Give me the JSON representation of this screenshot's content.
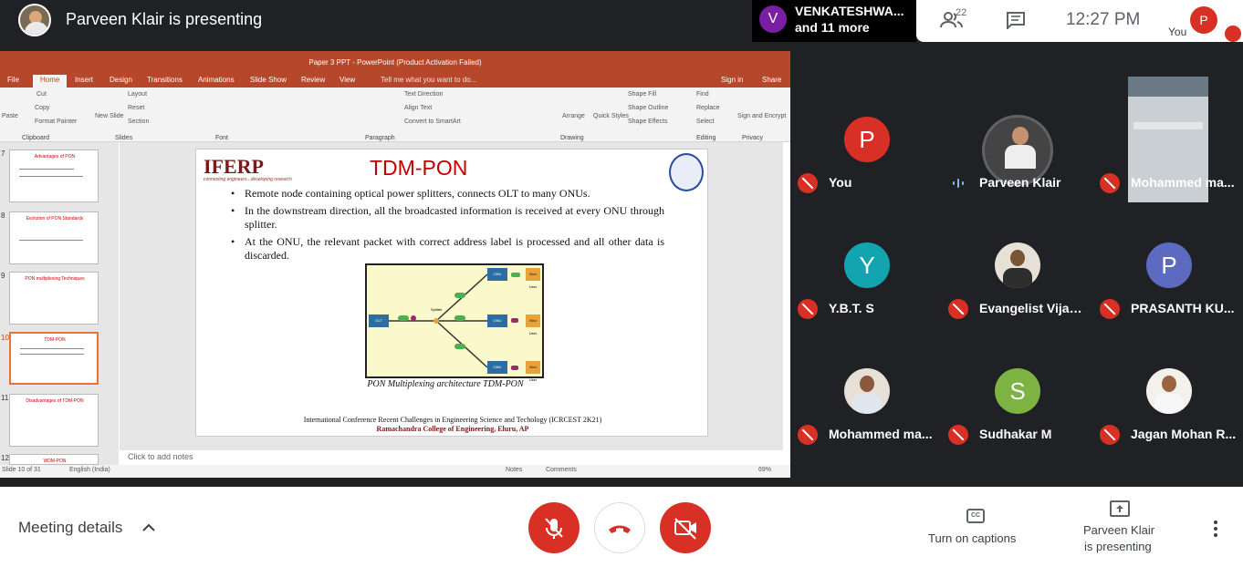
{
  "topbar": {
    "presenter_title": "Parveen Klair is presenting",
    "participant_name": "VENKATESHWA...",
    "participant_more": "and 11 more",
    "participant_initial": "V",
    "people_count": "22",
    "time": "12:27  PM",
    "self_initial": "P",
    "self_label": "You"
  },
  "ppt": {
    "title": "Paper 3 PPT - PowerPoint (Product Activation Failed)",
    "tabs": [
      "File",
      "Home",
      "Insert",
      "Design",
      "Transitions",
      "Animations",
      "Slide Show",
      "Review",
      "View"
    ],
    "tell_me": "Tell me what you want to do...",
    "sign_in": "Sign in",
    "share": "Share",
    "groups": [
      "Clipboard",
      "Slides",
      "Font",
      "Paragraph",
      "Drawing",
      "Editing",
      "Privacy"
    ],
    "buttons": {
      "paste": "Paste",
      "cut": "Cut",
      "copy": "Copy",
      "format_painter": "Format Painter",
      "new_slide": "New Slide",
      "layout": "Layout",
      "reset": "Reset",
      "section": "Section",
      "text_direction": "Text Direction",
      "align_text": "Align Text",
      "convert_smartart": "Convert to SmartArt",
      "arrange": "Arrange",
      "quick_styles": "Quick Styles",
      "shape_fill": "Shape Fill",
      "shape_outline": "Shape Outline",
      "shape_effects": "Shape Effects",
      "find": "Find",
      "replace": "Replace",
      "select": "Select",
      "sign_encrypt": "Sign and Encrypt"
    },
    "thumbnails": [
      {
        "num": "7",
        "title": "Advantages of PON"
      },
      {
        "num": "8",
        "title": "Evolution of PON Standards"
      },
      {
        "num": "9",
        "title": "PON multiplexing Techniques"
      },
      {
        "num": "10",
        "title": "TDM-PON"
      },
      {
        "num": "11",
        "title": "Disadvantages of TDM-PON"
      },
      {
        "num": "12",
        "title": "WDM-PON"
      }
    ],
    "notes_placeholder": "Click to add notes",
    "status_slide": "Slide 10 of 31",
    "status_lang": "English (India)",
    "status_notes": "Notes",
    "status_comments": "Comments",
    "zoom": "69%"
  },
  "slide": {
    "brand": "IFERP",
    "brand_tag": "connecting engineers...developing research",
    "title": "TDM-PON",
    "bullets": [
      "Remote node containing optical power splitters, connects OLT to many ONUs.",
      "In the downstream direction, all the broadcasted information is received at every ONU through splitter.",
      "At the ONU, the relevant packet with correct address label is processed and all other data is discarded."
    ],
    "diagram": {
      "olt": "OLT",
      "onu": "ONU",
      "splitter": "Splitter",
      "end_user": "End User"
    },
    "caption": "PON Multiplexing architecture TDM-PON",
    "footer_line1": "International Conference Recent Challenges in Engineering Science and Techology (ICRCEST 2K21)",
    "footer_line2": "Ramachandra College of Engineering, Eluru, AP"
  },
  "tiles": [
    {
      "name": "You",
      "initial": "P",
      "color": "#d93025",
      "muted": true
    },
    {
      "name": "Parveen Klair",
      "photo": true,
      "muted": false,
      "speaking": true
    },
    {
      "name": "Mohammed ma...",
      "video": true,
      "muted": true
    },
    {
      "name": "Y.B.T. S",
      "initial": "Y",
      "color": "#12a4af",
      "muted": true
    },
    {
      "name": "Evangelist Vijayk...",
      "photo": true,
      "muted": true
    },
    {
      "name": "PRASANTH KU...",
      "initial": "P",
      "color": "#5c6bc0",
      "muted": true
    },
    {
      "name": "Mohammed ma...",
      "photo": true,
      "muted": true
    },
    {
      "name": "Sudhakar M",
      "initial": "S",
      "color": "#7cb342",
      "muted": true
    },
    {
      "name": "Jagan Mohan R...",
      "photo": true,
      "muted": true
    }
  ],
  "bottom": {
    "meeting_details": "Meeting details",
    "captions": "Turn on captions",
    "presenting_line1": "Parveen Klair",
    "presenting_line2": "is presenting"
  }
}
